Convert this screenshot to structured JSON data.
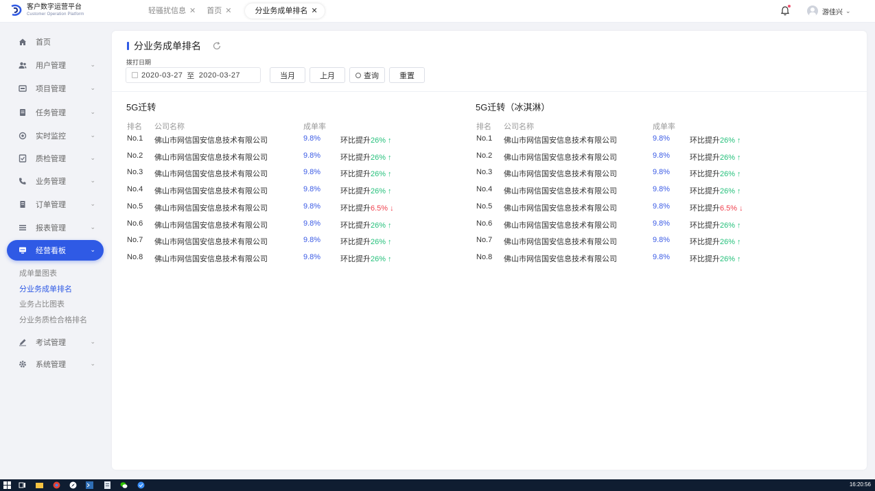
{
  "header": {
    "logo_title": "客户数字运营平台",
    "logo_subtitle": "Customer Operation Platform",
    "tabs": [
      {
        "label": "轻骚扰信息"
      },
      {
        "label": "首页"
      },
      {
        "label": "分业务成单排名",
        "active": true
      }
    ],
    "user_name": "游佳兴",
    "accent_color": "#2f5ae5"
  },
  "sidebar": {
    "items": [
      {
        "label": "首页",
        "icon": "home-icon"
      },
      {
        "label": "用户管理",
        "icon": "users-icon"
      },
      {
        "label": "项目管理",
        "icon": "project-icon"
      },
      {
        "label": "任务管理",
        "icon": "task-icon"
      },
      {
        "label": "实时监控",
        "icon": "monitor-icon"
      },
      {
        "label": "质检管理",
        "icon": "quality-icon"
      },
      {
        "label": "业务管理",
        "icon": "phone-icon"
      },
      {
        "label": "订单管理",
        "icon": "order-icon"
      },
      {
        "label": "报表管理",
        "icon": "report-icon"
      },
      {
        "label": "经营看板",
        "icon": "dashboard-icon",
        "active": true
      },
      {
        "label": "考试管理",
        "icon": "pen-icon"
      },
      {
        "label": "系统管理",
        "icon": "settings-icon"
      }
    ],
    "subitems": [
      {
        "label": "成单量图表"
      },
      {
        "label": "分业务成单排名",
        "active": true
      },
      {
        "label": "业务占比图表"
      },
      {
        "label": "分业务质检合格排名"
      }
    ]
  },
  "main": {
    "title": "分业务成单排名",
    "filter_label": "拨打日期",
    "date_start": "2020-03-27",
    "date_sep": "至",
    "date_end": "2020-03-27",
    "buttons": {
      "this_month": "当月",
      "last_month": "上月",
      "query": "查询",
      "reset": "重置"
    },
    "columns": {
      "rank": "排名",
      "company": "公司名称",
      "rate": "成单率"
    },
    "trend_prefix": "环比提升",
    "panels": [
      {
        "title": "5G迁转",
        "rows": [
          {
            "rank": "No.1",
            "company": "佛山市网信国安信息技术有限公司",
            "rate": "9.8%",
            "change": "26%",
            "arrow": "↑",
            "dir": "up"
          },
          {
            "rank": "No.2",
            "company": "佛山市网信国安信息技术有限公司",
            "rate": "9.8%",
            "change": "26%",
            "arrow": "↑",
            "dir": "up"
          },
          {
            "rank": "No.3",
            "company": "佛山市网信国安信息技术有限公司",
            "rate": "9.8%",
            "change": "26%",
            "arrow": "↑",
            "dir": "up"
          },
          {
            "rank": "No.4",
            "company": "佛山市网信国安信息技术有限公司",
            "rate": "9.8%",
            "change": "26%",
            "arrow": "↑",
            "dir": "up"
          },
          {
            "rank": "No.5",
            "company": "佛山市网信国安信息技术有限公司",
            "rate": "9.8%",
            "change": "6.5%",
            "arrow": "↓",
            "dir": "down"
          },
          {
            "rank": "No.6",
            "company": "佛山市网信国安信息技术有限公司",
            "rate": "9.8%",
            "change": "26%",
            "arrow": "↑",
            "dir": "up"
          },
          {
            "rank": "No.7",
            "company": "佛山市网信国安信息技术有限公司",
            "rate": "9.8%",
            "change": "26%",
            "arrow": "↑",
            "dir": "up"
          },
          {
            "rank": "No.8",
            "company": "佛山市网信国安信息技术有限公司",
            "rate": "9.8%",
            "change": "26%",
            "arrow": "↑",
            "dir": "up"
          }
        ]
      },
      {
        "title": "5G迁转（冰淇淋）",
        "rows": [
          {
            "rank": "No.1",
            "company": "佛山市网信国安信息技术有限公司",
            "rate": "9.8%",
            "change": "26%",
            "arrow": "↑",
            "dir": "up"
          },
          {
            "rank": "No.2",
            "company": "佛山市网信国安信息技术有限公司",
            "rate": "9.8%",
            "change": "26%",
            "arrow": "↑",
            "dir": "up"
          },
          {
            "rank": "No.3",
            "company": "佛山市网信国安信息技术有限公司",
            "rate": "9.8%",
            "change": "26%",
            "arrow": "↑",
            "dir": "up"
          },
          {
            "rank": "No.4",
            "company": "佛山市网信国安信息技术有限公司",
            "rate": "9.8%",
            "change": "26%",
            "arrow": "↑",
            "dir": "up"
          },
          {
            "rank": "No.5",
            "company": "佛山市网信国安信息技术有限公司",
            "rate": "9.8%",
            "change": "6.5%",
            "arrow": "↓",
            "dir": "down"
          },
          {
            "rank": "No.6",
            "company": "佛山市网信国安信息技术有限公司",
            "rate": "9.8%",
            "change": "26%",
            "arrow": "↑",
            "dir": "up"
          },
          {
            "rank": "No.7",
            "company": "佛山市网信国安信息技术有限公司",
            "rate": "9.8%",
            "change": "26%",
            "arrow": "↑",
            "dir": "up"
          },
          {
            "rank": "No.8",
            "company": "佛山市网信国安信息技术有限公司",
            "rate": "9.8%",
            "change": "26%",
            "arrow": "↑",
            "dir": "up"
          }
        ]
      }
    ]
  },
  "taskbar": {
    "time": "16:20:56"
  }
}
